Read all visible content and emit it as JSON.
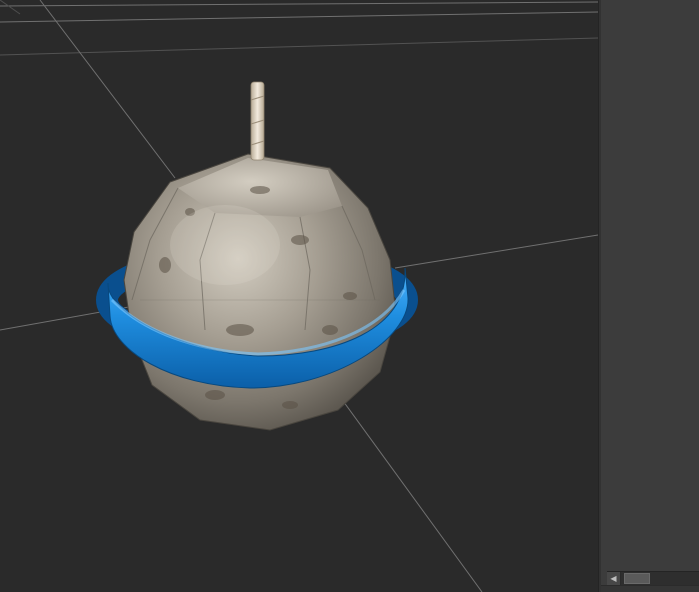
{
  "app": {
    "viewport": {
      "background": "#2a2a2a",
      "grid_color": "#7d7d7d",
      "model": {
        "stone_color": "#a49d92",
        "band_color": "#1e8ad9",
        "wick_color": "#e6dccc"
      }
    },
    "side_panel": {
      "background": "#3c3c3c"
    },
    "scrollbar": {
      "left_arrow": "◀"
    }
  }
}
